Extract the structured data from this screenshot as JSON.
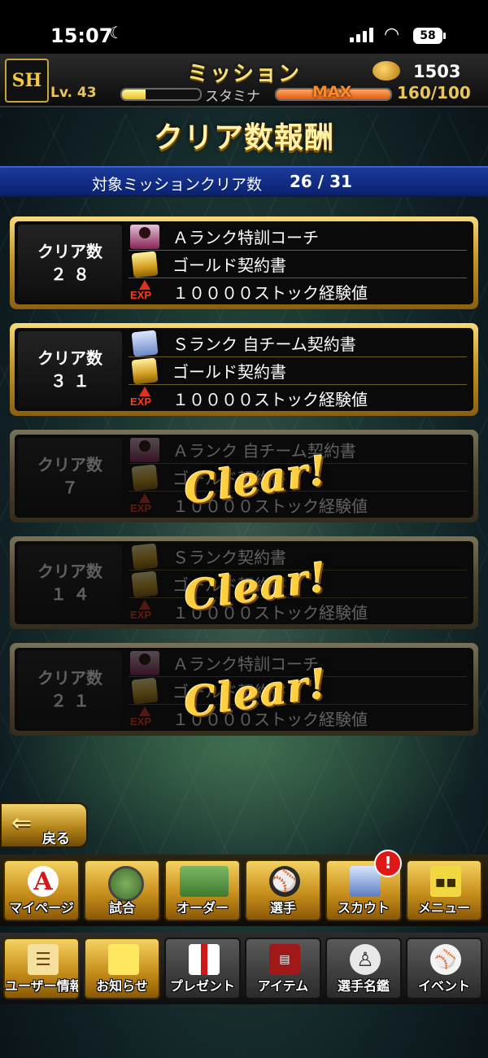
{
  "status_bar": {
    "time": "15:07",
    "battery": "58"
  },
  "header": {
    "logo": "SH",
    "title": "ミッション",
    "coins": "1503",
    "level": "Lv. 43",
    "stamina_label": "スタミナ",
    "stamina_max": "MAX",
    "stamina_value": "160/100",
    "exp_progress": 0.3,
    "stamina_progress": 1.0
  },
  "section": {
    "title": "クリア数報酬",
    "count_label": "対象ミッションクリア数",
    "count_value": "26 / 31"
  },
  "rewards": [
    {
      "label": "クリア数",
      "count": "２８",
      "cleared": false,
      "items": [
        {
          "icon": "coach-card-icon",
          "text": "Ａランク特訓コーチ"
        },
        {
          "icon": "gold-contract-icon",
          "text": "ゴールド契約書"
        },
        {
          "icon": "exp-icon",
          "text": "１００００ストック経験値"
        }
      ]
    },
    {
      "label": "クリア数",
      "count": "３１",
      "cleared": false,
      "items": [
        {
          "icon": "team-contract-icon",
          "text": "Ｓランク 自チーム契約書"
        },
        {
          "icon": "gold-contract-icon",
          "text": "ゴールド契約書"
        },
        {
          "icon": "exp-icon",
          "text": "１００００ストック経験値"
        }
      ]
    },
    {
      "label": "クリア数",
      "count": "７",
      "cleared": true,
      "items": [
        {
          "icon": "team-contract-icon",
          "text": "Ａランク 自チーム契約書"
        },
        {
          "icon": "gold-contract-icon",
          "text": "ゴールド契約書"
        },
        {
          "icon": "exp-icon",
          "text": "１００００ストック経験値"
        }
      ]
    },
    {
      "label": "クリア数",
      "count": "１４",
      "cleared": true,
      "items": [
        {
          "icon": "gold-contract-icon",
          "text": "Ｓランク契約書"
        },
        {
          "icon": "gold-contract-icon",
          "text": "ゴールド契約書"
        },
        {
          "icon": "exp-icon",
          "text": "１００００ストック経験値"
        }
      ]
    },
    {
      "label": "クリア数",
      "count": "２１",
      "cleared": true,
      "items": [
        {
          "icon": "coach-card-icon",
          "text": "Ａランク特訓コーチ"
        },
        {
          "icon": "gold-contract-icon",
          "text": "ゴールド契約書"
        },
        {
          "icon": "exp-icon",
          "text": "１００００ストック経験値"
        }
      ]
    }
  ],
  "clear_stamp": "Clear!",
  "back_button": {
    "label": "戻る"
  },
  "nav_main": [
    {
      "label": "マイページ",
      "icon": "letter-a-icon"
    },
    {
      "label": "試合",
      "icon": "stadium-icon"
    },
    {
      "label": "オーダー",
      "icon": "field-icon"
    },
    {
      "label": "選手",
      "icon": "player-icon"
    },
    {
      "label": "スカウト",
      "icon": "scout-icon"
    },
    {
      "label": "メニュー",
      "icon": "menu-icon"
    }
  ],
  "scout_badge": "!",
  "nav_sub": [
    {
      "label": "ユーザー情報",
      "icon": "user-info-icon"
    },
    {
      "label": "お知らせ",
      "icon": "notice-icon"
    },
    {
      "label": "プレゼント",
      "icon": "gift-icon"
    },
    {
      "label": "アイテム",
      "icon": "item-icon"
    },
    {
      "label": "選手名鑑",
      "icon": "player-book-icon"
    },
    {
      "label": "イベント",
      "icon": "event-icon"
    }
  ],
  "colors": {
    "gold": "#c59525",
    "navy_bar": "#0b2270",
    "stamp": "#ffcf40"
  }
}
